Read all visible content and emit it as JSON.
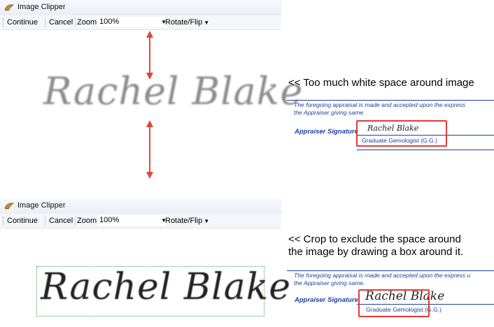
{
  "window": {
    "title": "Image Clipper"
  },
  "toolbar": {
    "continue": "Continue",
    "cancel": "Cancel",
    "zoom_label": "Zoom",
    "zoom_value": "100%",
    "rotate_flip": "Rotate/Flip"
  },
  "signature": {
    "text": "Rachel Blake"
  },
  "annotations": {
    "top": "<< Too much white space around image",
    "bottom_line1": "<< Crop to exclude the space around",
    "bottom_line2": "the image by drawing a box around it."
  },
  "report": {
    "para_line1_top": "The foregoing appraisal is made and accepted upon the express",
    "para_line1_bottom": "The foregoing appraisal is made and accepted upon the express u",
    "para_line2": "the Appraiser giving same.",
    "signature_label": "Appraiser Signature",
    "appraiser_title": "Graduate Gemologist (G.G.)"
  },
  "colors": {
    "highlight": "#e13a3a",
    "arrow": "#e0463e",
    "report_text": "#1f3f9c",
    "selection": "#39a845"
  },
  "icons": {
    "app": "image-clipper-icon",
    "arrow": "double-headed-arrow"
  }
}
